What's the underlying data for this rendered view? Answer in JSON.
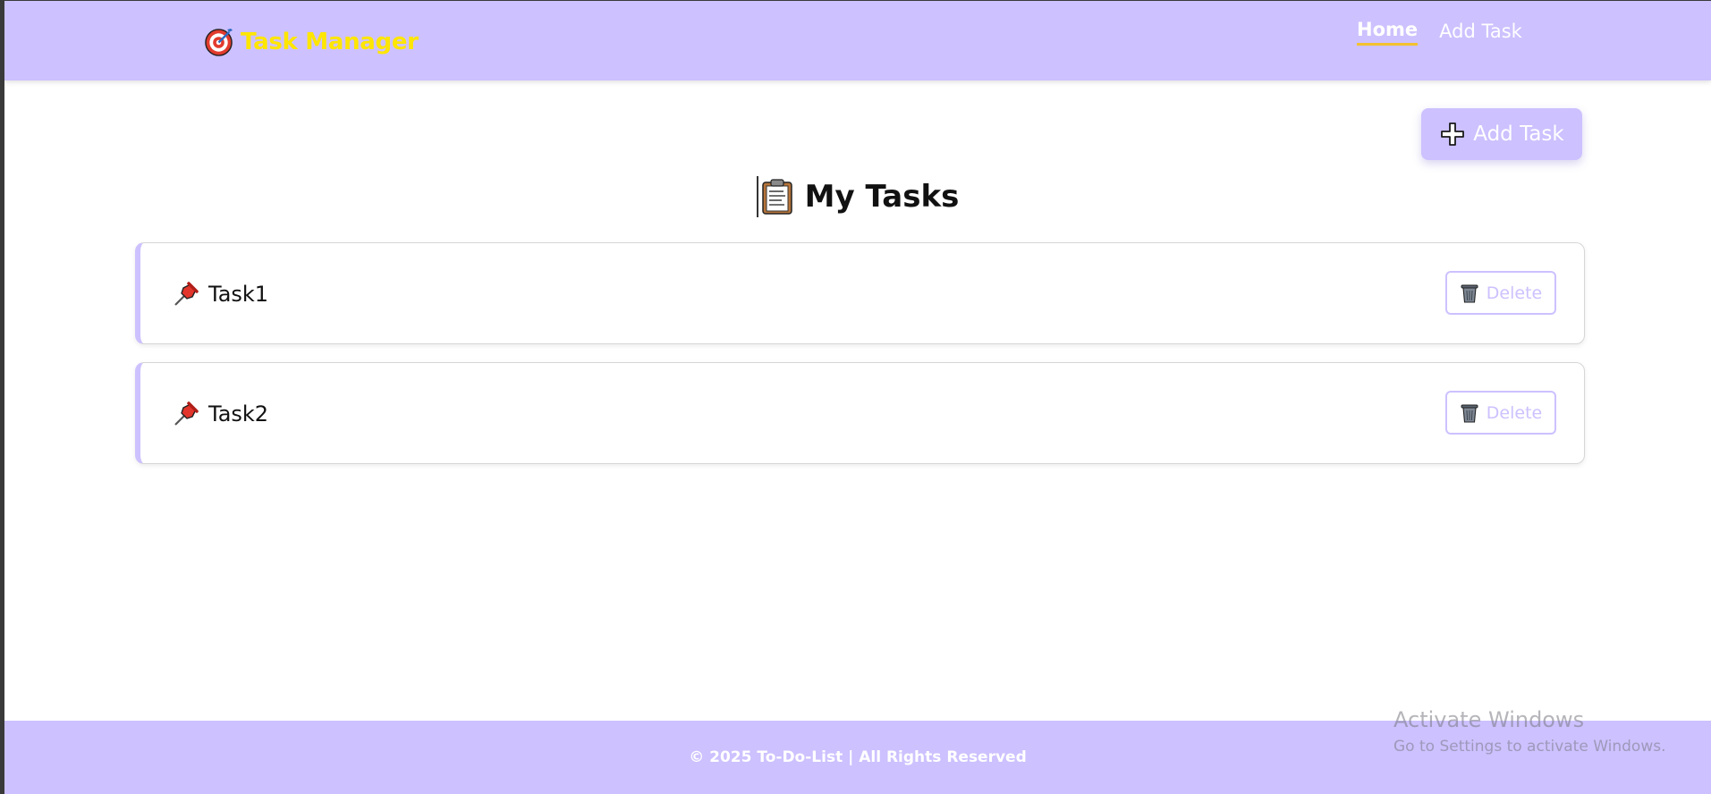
{
  "header": {
    "brand_title": "Task Manager",
    "brand_icon": "target-icon",
    "nav": [
      {
        "label": "Home",
        "active": true
      },
      {
        "label": "Add Task",
        "active": false
      }
    ]
  },
  "toolbar": {
    "add_task_label": "Add Task",
    "add_task_icon": "plus-icon"
  },
  "main": {
    "title": "My Tasks",
    "title_icon": "clipboard-icon",
    "tasks": [
      {
        "name": "Task1",
        "delete_label": "Delete"
      },
      {
        "name": "Task2",
        "delete_label": "Delete"
      }
    ]
  },
  "footer": {
    "text": "© 2025 To-Do-List | All Rights Reserved"
  },
  "overlay": {
    "watermark_title": "Activate Windows",
    "watermark_sub": "Go to Settings to activate Windows."
  },
  "colors": {
    "accent": "#cdc1ff",
    "brand_text": "#ffe600",
    "nav_underline": "#f2c22e"
  }
}
